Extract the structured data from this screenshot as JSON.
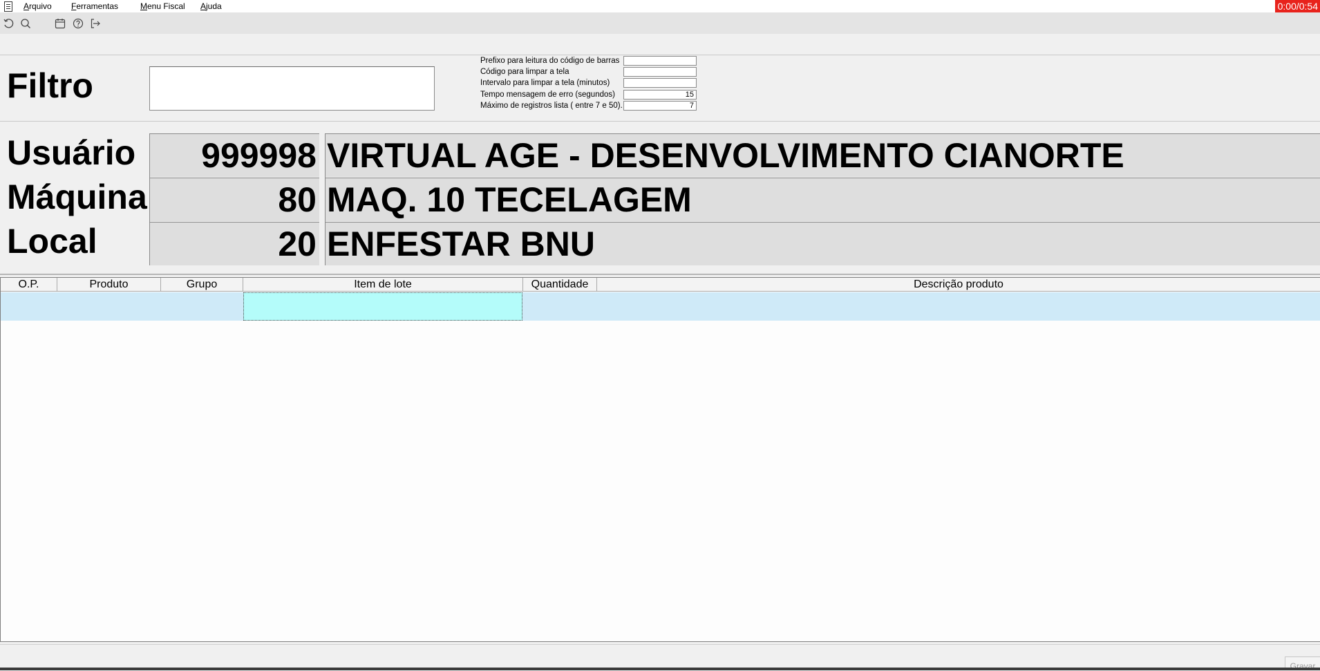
{
  "menubar": {
    "items": [
      {
        "underline": "A",
        "rest": "rquivo"
      },
      {
        "underline": "F",
        "rest": "erramentas"
      },
      {
        "underline": "M",
        "rest": "enu Fiscal"
      },
      {
        "underline": "A",
        "rest": "juda"
      }
    ],
    "timer": "0:00/0:54"
  },
  "toolbar": {
    "icons": [
      "undo-icon",
      "search-icon",
      "calendar-icon",
      "help-icon",
      "exit-icon"
    ]
  },
  "filter": {
    "label": "Filtro",
    "value": ""
  },
  "config": {
    "fields": [
      {
        "label": "Prefixo para leitura do código de barras",
        "value": ""
      },
      {
        "label": "Código para limpar a tela",
        "value": ""
      },
      {
        "label": "Intervalo para limpar a tela (minutos)",
        "value": ""
      },
      {
        "label": "Tempo mensagem de erro (segundos)",
        "value": "15"
      },
      {
        "label": "Máximo de registros lista ( entre 7 e 50).",
        "value": "7"
      }
    ]
  },
  "info": {
    "usuario": {
      "label": "Usuário",
      "code": "999998",
      "name": "VIRTUAL AGE - DESENVOLVIMENTO CIANORTE"
    },
    "maquina": {
      "label": "Máquina",
      "code": "80",
      "name": "MAQ. 10 TECELAGEM"
    },
    "local": {
      "label": "Local",
      "code": "20",
      "name": "ENFESTAR BNU"
    }
  },
  "grid": {
    "columns": [
      "O.P.",
      "Produto",
      "Grupo",
      "Item de lote",
      "Quantidade",
      "Descrição produto"
    ],
    "rows": [
      [
        "",
        "",
        "",
        "",
        "",
        ""
      ]
    ]
  },
  "statusbar": {
    "gravar_label": "Gravar"
  },
  "colors": {
    "timer_bg": "#e8231c",
    "row_highlight": "#cfeaf8",
    "active_cell": "#b4fcfa"
  }
}
